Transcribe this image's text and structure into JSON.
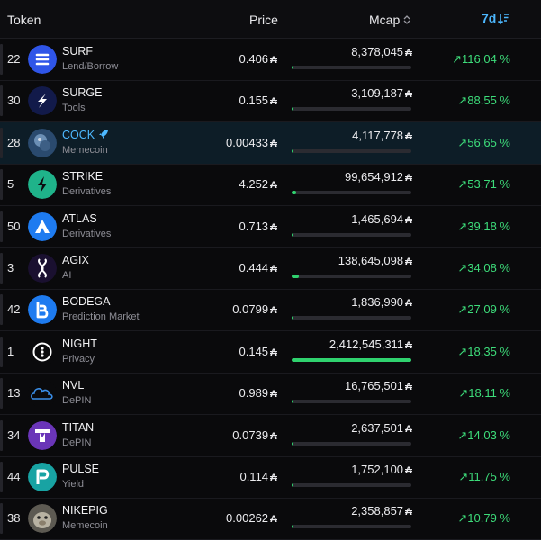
{
  "header": {
    "token": "Token",
    "price": "Price",
    "mcap": "Mcap",
    "period": "7d"
  },
  "unit_symbol": "₳",
  "rows": [
    {
      "rank": "22",
      "name": "SURF",
      "category": "Lend/Borrow",
      "price": "0.406",
      "mcap": "8,378,045",
      "change": "↗116.04 %",
      "logo": "surf-logo-icon",
      "mcap_share": 0.003,
      "highlight": false
    },
    {
      "rank": "30",
      "name": "SURGE",
      "category": "Tools",
      "price": "0.155",
      "mcap": "3,109,187",
      "change": "↗88.55 %",
      "logo": "surge-logo-icon",
      "mcap_share": 0.001,
      "highlight": false
    },
    {
      "rank": "28",
      "name": "COCK",
      "category": "Memecoin",
      "price": "0.00433",
      "mcap": "4,117,778",
      "change": "↗56.65 %",
      "logo": "cock-logo-icon",
      "mcap_share": 0.002,
      "highlight": true
    },
    {
      "rank": "5",
      "name": "STRIKE",
      "category": "Derivatives",
      "price": "4.252",
      "mcap": "99,654,912",
      "change": "↗53.71 %",
      "logo": "strike-logo-icon",
      "mcap_share": 0.041,
      "highlight": false
    },
    {
      "rank": "50",
      "name": "ATLAS",
      "category": "Derivatives",
      "price": "0.713",
      "mcap": "1,465,694",
      "change": "↗39.18 %",
      "logo": "atlas-logo-icon",
      "mcap_share": 0.001,
      "highlight": false
    },
    {
      "rank": "3",
      "name": "AGIX",
      "category": "AI",
      "price": "0.444",
      "mcap": "138,645,098",
      "change": "↗34.08 %",
      "logo": "agix-logo-icon",
      "mcap_share": 0.057,
      "highlight": false
    },
    {
      "rank": "42",
      "name": "BODEGA",
      "category": "Prediction Market",
      "price": "0.0799",
      "mcap": "1,836,990",
      "change": "↗27.09 %",
      "logo": "bodega-logo-icon",
      "mcap_share": 0.001,
      "highlight": false
    },
    {
      "rank": "1",
      "name": "NIGHT",
      "category": "Privacy",
      "price": "0.145",
      "mcap": "2,412,545,311",
      "change": "↗18.35 %",
      "logo": "night-logo-icon",
      "mcap_share": 1.0,
      "highlight": false
    },
    {
      "rank": "13",
      "name": "NVL",
      "category": "DePIN",
      "price": "0.989",
      "mcap": "16,765,501",
      "change": "↗18.11 %",
      "logo": "nvl-logo-icon",
      "mcap_share": 0.007,
      "highlight": false
    },
    {
      "rank": "34",
      "name": "TITAN",
      "category": "DePIN",
      "price": "0.0739",
      "mcap": "2,637,501",
      "change": "↗14.03 %",
      "logo": "titan-logo-icon",
      "mcap_share": 0.001,
      "highlight": false
    },
    {
      "rank": "44",
      "name": "PULSE",
      "category": "Yield",
      "price": "0.114",
      "mcap": "1,752,100",
      "change": "↗11.75 %",
      "logo": "pulse-logo-icon",
      "mcap_share": 0.001,
      "highlight": false
    },
    {
      "rank": "38",
      "name": "NIKEPIG",
      "category": "Memecoin",
      "price": "0.00262",
      "mcap": "2,358,857",
      "change": "↗10.79 %",
      "logo": "nikepig-logo-icon",
      "mcap_share": 0.001,
      "highlight": false
    }
  ],
  "colors": {
    "accent": "#4db8ff",
    "positive": "#3ddc7a",
    "bar_fill": "#2fd26e"
  }
}
